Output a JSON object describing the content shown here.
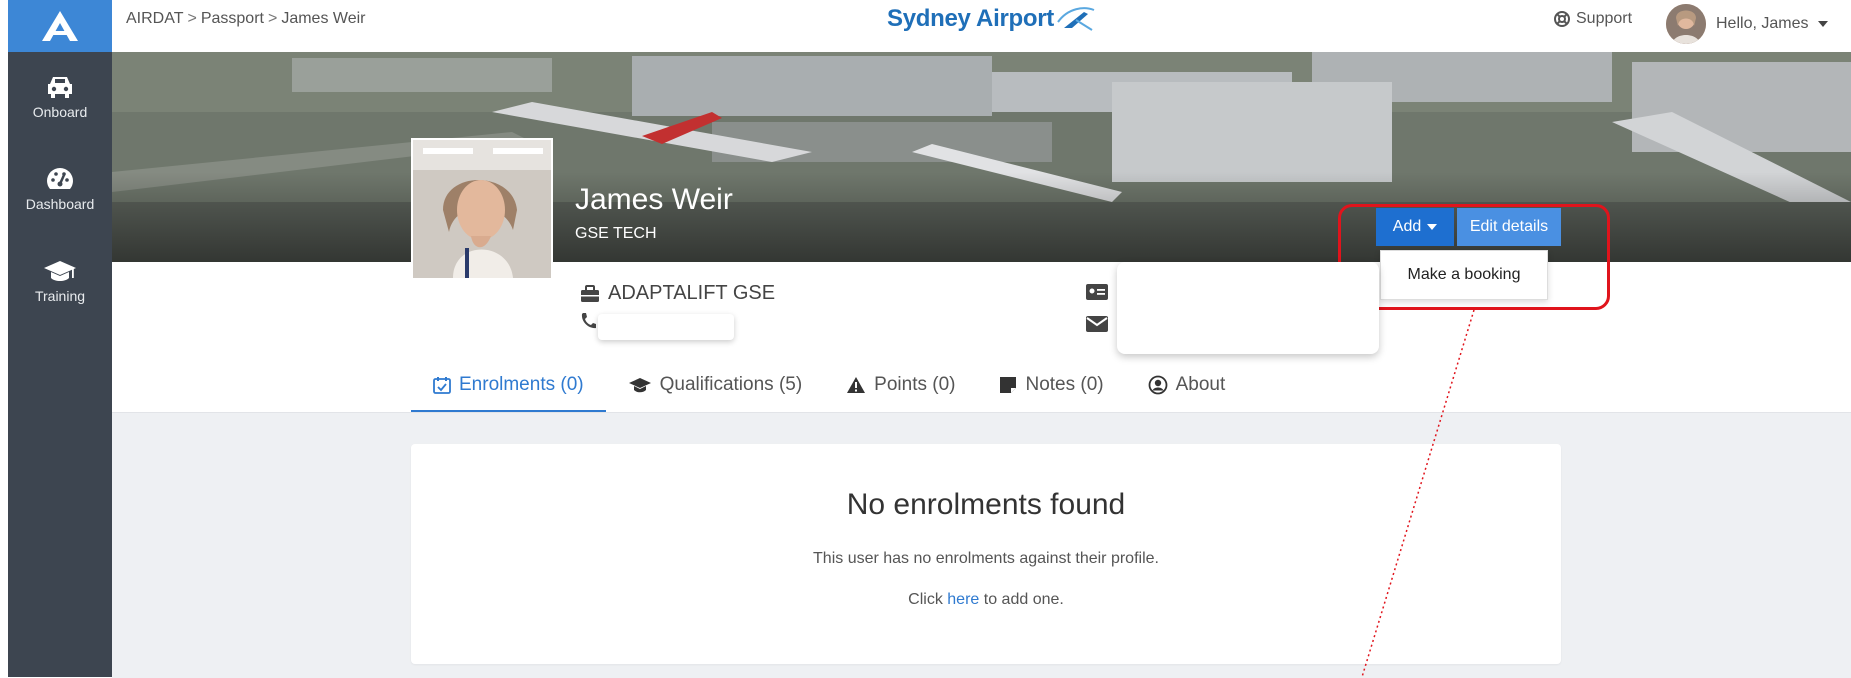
{
  "breadcrumb": {
    "root": "AIRDAT",
    "section": "Passport",
    "current": "James Weir",
    "separator": ">"
  },
  "brand": {
    "name": "Sydney Airport"
  },
  "header": {
    "support_label": "Support",
    "greeting": "Hello, James"
  },
  "sidebar": {
    "items": [
      {
        "label": "Onboard",
        "icon": "car-icon"
      },
      {
        "label": "Dashboard",
        "icon": "speedometer-icon"
      },
      {
        "label": "Training",
        "icon": "graduation-cap-icon"
      }
    ]
  },
  "profile": {
    "name": "James Weir",
    "role": "GSE TECH",
    "organisation": "ADAPTALIFT GSE"
  },
  "actions": {
    "add_label": "Add",
    "edit_label": "Edit details",
    "dropdown_items": [
      "Make a booking"
    ]
  },
  "tabs": [
    {
      "label": "Enrolments (0)",
      "icon": "calendar-check-icon",
      "active": true
    },
    {
      "label": "Qualifications (5)",
      "icon": "graduation-cap-icon",
      "active": false
    },
    {
      "label": "Points (0)",
      "icon": "warning-icon",
      "active": false
    },
    {
      "label": "Notes (0)",
      "icon": "note-icon",
      "active": false
    },
    {
      "label": "About",
      "icon": "user-circle-icon",
      "active": false
    }
  ],
  "empty_state": {
    "title": "No enrolments found",
    "subtitle": "This user has no enrolments against their profile.",
    "action_prefix": "Click",
    "action_link": "here",
    "action_suffix": "to add one."
  },
  "colors": {
    "sidebar_bg": "#3d4550",
    "accent": "#1e6fd0",
    "brand": "#1f6fb8",
    "highlight": "#e0141c"
  }
}
